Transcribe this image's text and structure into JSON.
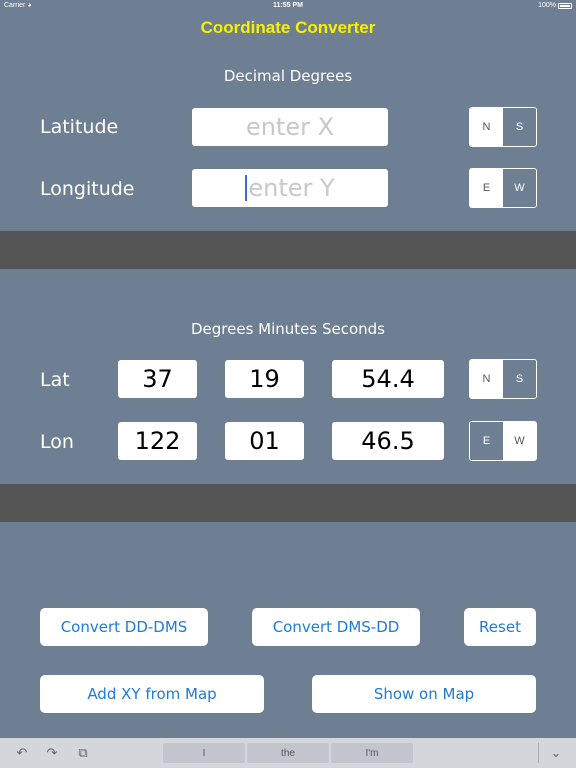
{
  "status": {
    "carrier": "Carrier",
    "wifi_icon": "wifi-icon",
    "time": "11:55 PM",
    "battery": "100%"
  },
  "title": "Coordinate Converter",
  "dd": {
    "heading": "Decimal Degrees",
    "latitude": {
      "label": "Latitude",
      "placeholder": "enter X",
      "value": "",
      "seg_left": "N",
      "seg_right": "S",
      "selected": "N"
    },
    "longitude": {
      "label": "Longitude",
      "placeholder": "enter Y",
      "value": "",
      "seg_left": "E",
      "seg_right": "W",
      "selected": "E"
    }
  },
  "dms": {
    "heading": "Degrees Minutes Seconds",
    "lat": {
      "label": "Lat",
      "deg": "37",
      "min": "19",
      "sec": "54.4",
      "seg_left": "N",
      "seg_right": "S",
      "selected": "N"
    },
    "lon": {
      "label": "Lon",
      "deg": "122",
      "min": "01",
      "sec": "46.5",
      "seg_left": "E",
      "seg_right": "W",
      "selected": "W"
    }
  },
  "buttons": {
    "convert_dd_dms": "Convert DD-DMS",
    "convert_dms_dd": "Convert DMS-DD",
    "reset": "Reset",
    "add_xy": "Add XY from Map",
    "show_map": "Show on Map"
  },
  "keyboard": {
    "suggestions": [
      "I",
      "the",
      "I'm"
    ],
    "undo_icon": "undo-icon",
    "redo_icon": "redo-icon",
    "paste_icon": "paste-icon",
    "dismiss_icon": "chevron-down-icon"
  },
  "colors": {
    "background": "#6f7f93",
    "title": "#f7f000",
    "band": "#555555",
    "button_text": "#1d7bd9"
  }
}
